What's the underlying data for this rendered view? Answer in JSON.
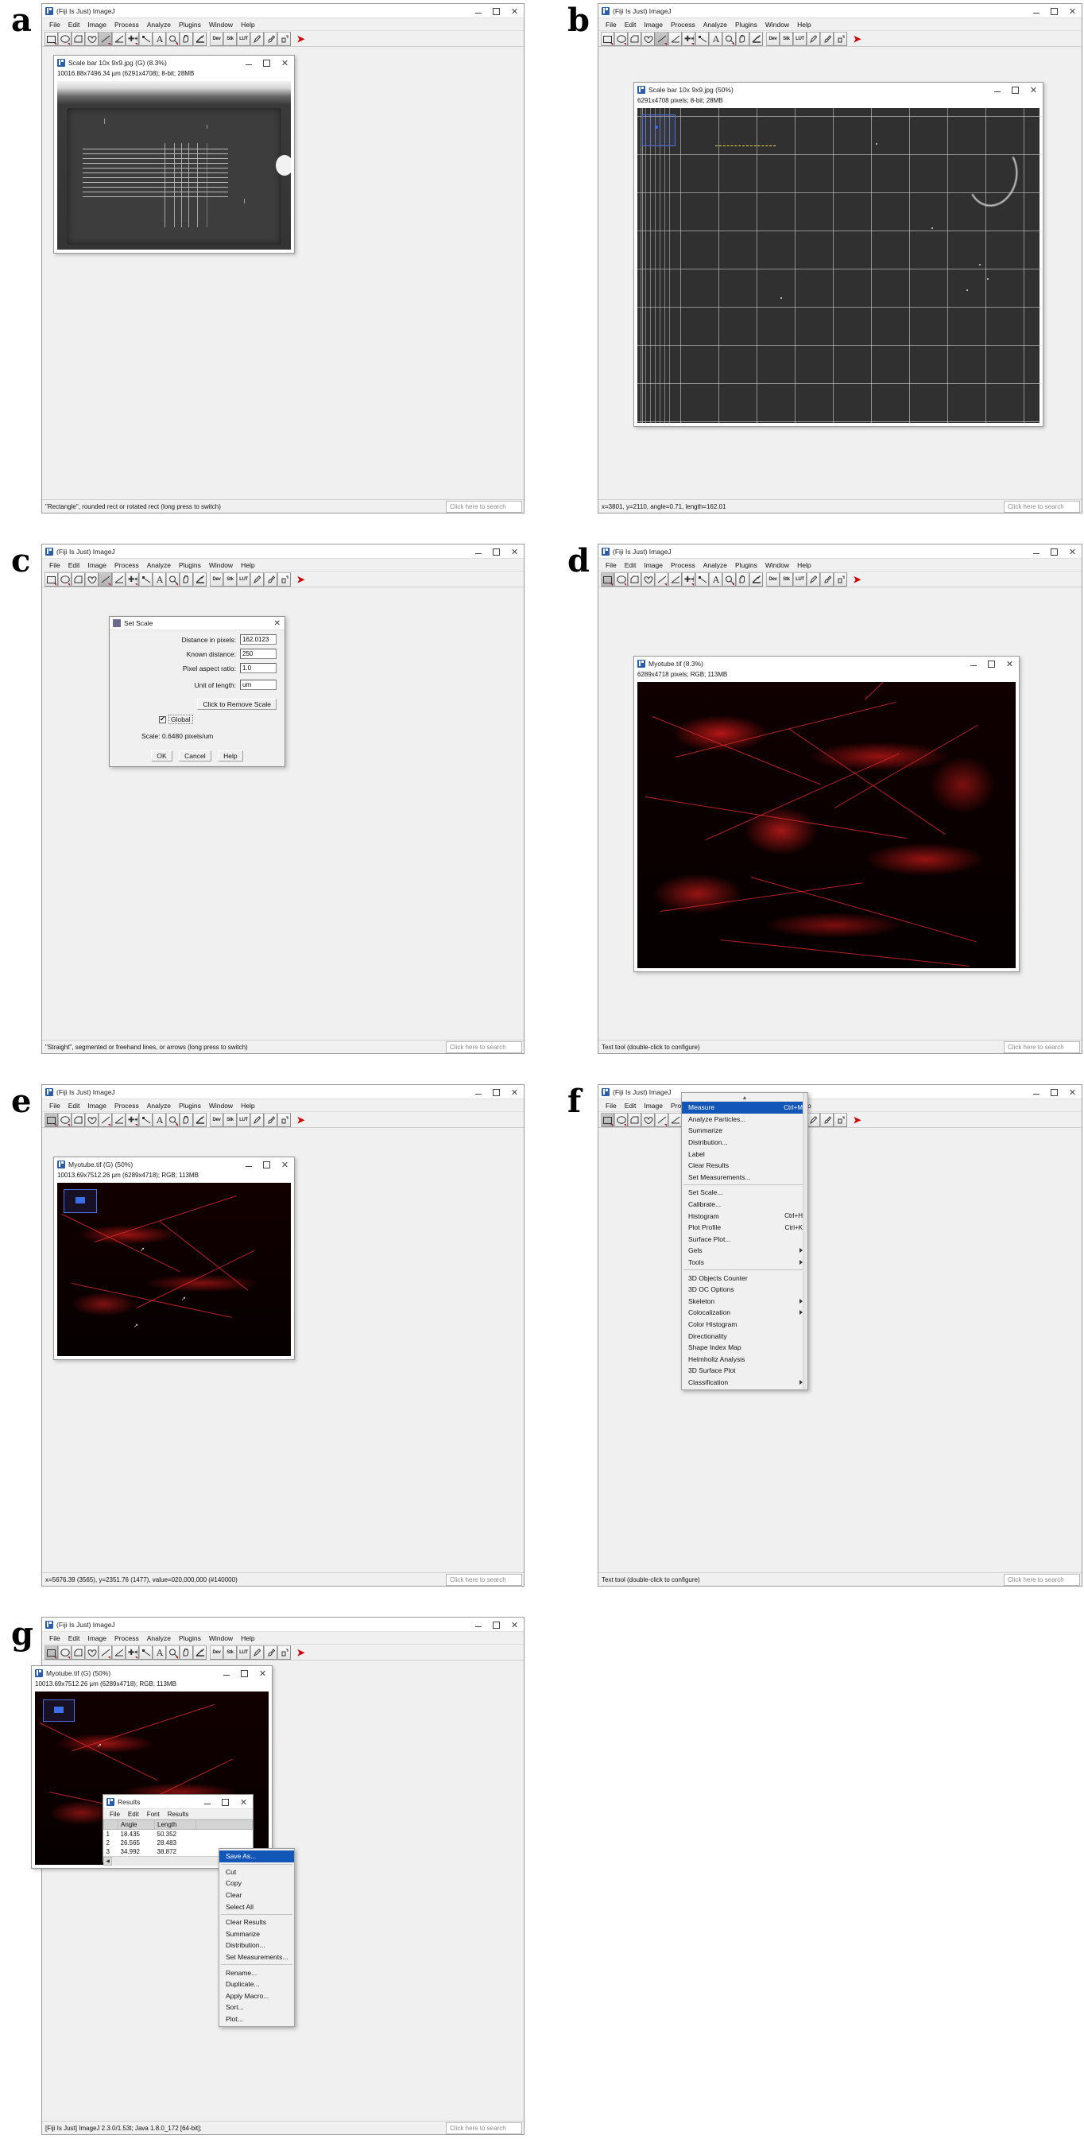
{
  "figure": {
    "panels": [
      "a",
      "b",
      "c",
      "d",
      "e",
      "f",
      "g"
    ]
  },
  "app": {
    "title": "(Fiji Is Just) ImageJ",
    "menus": [
      "File",
      "Edit",
      "Image",
      "Process",
      "Analyze",
      "Plugins",
      "Window",
      "Help"
    ],
    "toolbar_icons": [
      "rectangle-tool",
      "oval-tool",
      "polygon-tool",
      "freehand-tool",
      "line-tool",
      "angle-tool",
      "point-tool",
      "wand-tool",
      "text-tool",
      "magnifier-tool",
      "hand-tool",
      "dropper-tool",
      "dev-tool",
      "stk-tool",
      "lut-tool",
      "pencil-tool",
      "brush-tool",
      "spray-tool",
      "arrow-tool"
    ],
    "toolbar_text_buttons": [
      "Dev",
      "Stk",
      "LUT"
    ],
    "search_placeholder": "Click here to search",
    "version_status": "[Fiji Is Just] ImageJ 2.3.0/1.53t; Java 1.8.0_172 [64-bit];"
  },
  "panel_a": {
    "letter": "a",
    "window_title": "Scale bar 10x 9x9.jpg (G) (8.3%)",
    "image_info": "10016.88x7496.34 µm (6291x4708); 8-bit; 28MB",
    "status": "\"Rectangle\", rounded rect or rotated rect (long press to switch)",
    "search_placeholder": "Click here to search",
    "selected_tool": "line-tool"
  },
  "panel_b": {
    "letter": "b",
    "window_title": "Scale bar 10x 9x9.jpg (50%)",
    "image_info": "6291x4708 pixels; 8-bit; 28MB",
    "status": "x=3801, y=2110, angle=0.71, length=162.01",
    "search_placeholder": "Click here to search",
    "selected_tool": "line-tool"
  },
  "panel_c": {
    "letter": "c",
    "status": "\"Straight\", segmented or freehand lines, or arrows (long press to switch)",
    "search_placeholder": "Click here to search",
    "dialog": {
      "title": "Set Scale",
      "fields": [
        {
          "label": "Distance in pixels:",
          "value": "162.0123"
        },
        {
          "label": "Known distance:",
          "value": "250"
        },
        {
          "label": "Pixel aspect ratio:",
          "value": "1.0"
        },
        {
          "label": "Unit of length:",
          "value": "um"
        }
      ],
      "remove_scale_button": "Click to Remove Scale",
      "global_checkbox_label": "Global",
      "global_checked": true,
      "scale_text": "Scale: 0.6480 pixels/um",
      "buttons": [
        "OK",
        "Cancel",
        "Help"
      ]
    }
  },
  "panel_d": {
    "letter": "d",
    "window_title": "Myotube.tif (8.3%)",
    "image_info": "6289x4718 pixels; RGB; 113MB",
    "status": "Text tool (double-click to configure)",
    "search_placeholder": "Click here to search",
    "selected_tool": "rectangle-tool"
  },
  "panel_e": {
    "letter": "e",
    "window_title": "Myotube.tif (G) (50%)",
    "image_info": "10013.69x7512.26 µm (6289x4718); RGB; 113MB",
    "status": "x=5676.39 (3565), y=2351.76 (1477), value=020,000,000 (#140000)",
    "search_placeholder": "Click here to search",
    "selected_tool": "rectangle-tool"
  },
  "panel_f": {
    "letter": "f",
    "status": "Text tool (double-click to configure)",
    "search_placeholder": "Click here to search",
    "open_menu": "Analyze",
    "menu_items": [
      {
        "label": "Measure",
        "accel": "Ctrl+M",
        "selected": true
      },
      {
        "label": "Analyze Particles...",
        "accel": ""
      },
      {
        "label": "Summarize",
        "accel": ""
      },
      {
        "label": "Distribution...",
        "accel": ""
      },
      {
        "label": "Label",
        "accel": ""
      },
      {
        "label": "Clear Results",
        "accel": ""
      },
      {
        "label": "Set Measurements...",
        "accel": ""
      },
      {
        "separator": true
      },
      {
        "label": "Set Scale...",
        "accel": ""
      },
      {
        "label": "Calibrate...",
        "accel": ""
      },
      {
        "label": "Histogram",
        "accel": "Ctrl+H"
      },
      {
        "label": "Plot Profile",
        "accel": "Ctrl+K"
      },
      {
        "label": "Surface Plot...",
        "accel": ""
      },
      {
        "label": "Gels",
        "accel": "",
        "submenu": true
      },
      {
        "label": "Tools",
        "accel": "",
        "submenu": true
      },
      {
        "separator": true
      },
      {
        "label": "3D Objects Counter",
        "accel": ""
      },
      {
        "label": "3D OC Options",
        "accel": ""
      },
      {
        "label": "Skeleton",
        "accel": "",
        "submenu": true
      },
      {
        "label": "Colocalization",
        "accel": "",
        "submenu": true
      },
      {
        "label": "Color Histogram",
        "accel": ""
      },
      {
        "label": "Directionality",
        "accel": ""
      },
      {
        "label": "Shape Index Map",
        "accel": ""
      },
      {
        "label": "Helmholtz Analysis",
        "accel": ""
      },
      {
        "label": "3D Surface Plot",
        "accel": ""
      },
      {
        "label": "Classification",
        "accel": "",
        "submenu": true
      }
    ]
  },
  "panel_g": {
    "letter": "g",
    "window_title": "Myotube.tif (G) (50%)",
    "image_info": "10013.69x7512.26 µm (6289x4718); RGB; 113MB",
    "status": "[Fiji Is Just] ImageJ 2.3.0/1.53t; Java 1.8.0_172 [64-bit];",
    "search_placeholder": "Click here to search",
    "results": {
      "title": "Results",
      "menus": [
        "File",
        "Edit",
        "Font",
        "Results"
      ],
      "columns": [
        "",
        "Angle",
        "Length"
      ],
      "rows": [
        {
          "index": "1",
          "angle": "18.435",
          "length": "50.352"
        },
        {
          "index": "2",
          "angle": "26.565",
          "length": "28.483"
        },
        {
          "index": "3",
          "angle": "34.992",
          "length": "38.872"
        }
      ]
    },
    "context_menu": [
      {
        "label": "Save As...",
        "selected": true
      },
      {
        "separator": true
      },
      {
        "label": "Cut"
      },
      {
        "label": "Copy"
      },
      {
        "label": "Clear"
      },
      {
        "label": "Select All"
      },
      {
        "separator": true
      },
      {
        "label": "Clear Results"
      },
      {
        "label": "Summarize"
      },
      {
        "label": "Distribution..."
      },
      {
        "label": "Set Measurements..."
      },
      {
        "separator": true
      },
      {
        "label": "Rename..."
      },
      {
        "label": "Duplicate..."
      },
      {
        "label": "Apply Macro..."
      },
      {
        "label": "Sort..."
      },
      {
        "label": "Plot..."
      }
    ]
  },
  "colors": {
    "accent_blue": "#1256b8",
    "menu_highlight": "#2a5fd4",
    "window_bg": "#f0f0f0",
    "roi_blue": "#4d6fe0",
    "fluorescence_red": "#d21a1a",
    "arrow_red": "#cc0000"
  }
}
